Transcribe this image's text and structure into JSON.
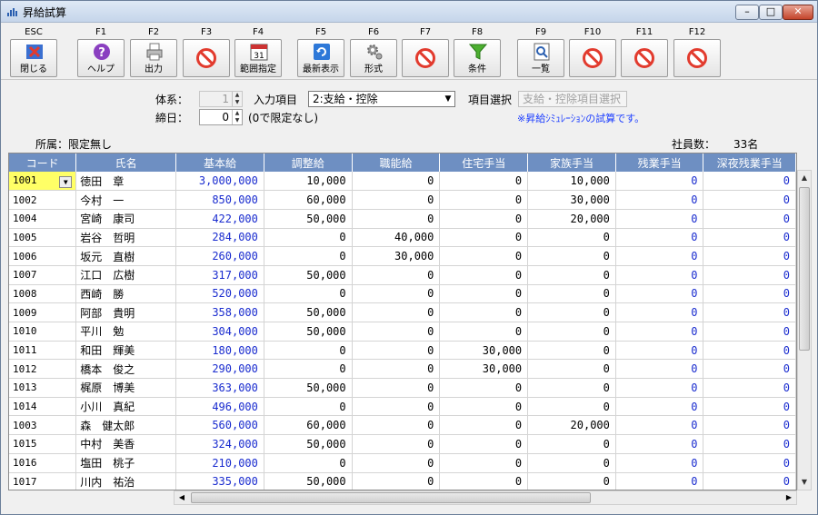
{
  "window": {
    "title": "昇給試算",
    "min": "–",
    "max": "□",
    "close": "✕"
  },
  "toolbar": [
    {
      "key": "ESC",
      "label": "閉じる",
      "icon": "close-icon"
    },
    {
      "key": "F1",
      "label": "ヘルプ",
      "icon": "help-icon"
    },
    {
      "key": "F2",
      "label": "出力",
      "icon": "printer-icon"
    },
    {
      "key": "F3",
      "label": "",
      "icon": "disabled-icon"
    },
    {
      "key": "F4",
      "label": "範囲指定",
      "icon": "calendar-icon",
      "badge": "31"
    },
    {
      "key": "F5",
      "label": "最新表示",
      "icon": "refresh-icon"
    },
    {
      "key": "F6",
      "label": "形式",
      "icon": "gear-icon"
    },
    {
      "key": "F7",
      "label": "",
      "icon": "disabled-icon"
    },
    {
      "key": "F8",
      "label": "条件",
      "icon": "filter-icon"
    },
    {
      "key": "F9",
      "label": "一覧",
      "icon": "list-icon"
    },
    {
      "key": "F10",
      "label": "",
      "icon": "disabled-icon"
    },
    {
      "key": "F11",
      "label": "",
      "icon": "disabled-icon"
    },
    {
      "key": "F12",
      "label": "",
      "icon": "disabled-icon"
    }
  ],
  "filters": {
    "taikei_label": "体系：",
    "taikei_value": "1",
    "input_item_label": "入力項目",
    "input_item_value": "2:支給・控除",
    "item_select_label": "項目選択",
    "item_select_value": "支給・控除項目選択",
    "shimebi_label": "締日：",
    "shimebi_value": "0",
    "shimebi_note": "(0で限定なし)",
    "note": "※昇給ｼﾐｭﾚｰｼｮﾝの試算です。",
    "affiliation": "所属：限定無し",
    "employee_count_label": "社員数：",
    "employee_count": "33名"
  },
  "columns": [
    "コード",
    "氏名",
    "基本給",
    "調整給",
    "職能給",
    "住宅手当",
    "家族手当",
    "残業手当",
    "深夜残業手当"
  ],
  "rows": [
    [
      "1001",
      "徳田　章",
      "3,000,000",
      "10,000",
      "0",
      "0",
      "10,000",
      "0",
      "0"
    ],
    [
      "1002",
      "今村　一",
      "850,000",
      "60,000",
      "0",
      "0",
      "30,000",
      "0",
      "0"
    ],
    [
      "1004",
      "宮崎　康司",
      "422,000",
      "50,000",
      "0",
      "0",
      "20,000",
      "0",
      "0"
    ],
    [
      "1005",
      "岩谷　哲明",
      "284,000",
      "0",
      "40,000",
      "0",
      "0",
      "0",
      "0"
    ],
    [
      "1006",
      "坂元　直樹",
      "260,000",
      "0",
      "30,000",
      "0",
      "0",
      "0",
      "0"
    ],
    [
      "1007",
      "江口　広樹",
      "317,000",
      "50,000",
      "0",
      "0",
      "0",
      "0",
      "0"
    ],
    [
      "1008",
      "西崎　勝",
      "520,000",
      "0",
      "0",
      "0",
      "0",
      "0",
      "0"
    ],
    [
      "1009",
      "阿部　貴明",
      "358,000",
      "50,000",
      "0",
      "0",
      "0",
      "0",
      "0"
    ],
    [
      "1010",
      "平川　勉",
      "304,000",
      "50,000",
      "0",
      "0",
      "0",
      "0",
      "0"
    ],
    [
      "1011",
      "和田　輝美",
      "180,000",
      "0",
      "0",
      "30,000",
      "0",
      "0",
      "0"
    ],
    [
      "1012",
      "橋本　俊之",
      "290,000",
      "0",
      "0",
      "30,000",
      "0",
      "0",
      "0"
    ],
    [
      "1013",
      "梶原　博美",
      "363,000",
      "50,000",
      "0",
      "0",
      "0",
      "0",
      "0"
    ],
    [
      "1014",
      "小川　真紀",
      "496,000",
      "0",
      "0",
      "0",
      "0",
      "0",
      "0"
    ],
    [
      "1003",
      "森　健太郎",
      "560,000",
      "60,000",
      "0",
      "0",
      "20,000",
      "0",
      "0"
    ],
    [
      "1015",
      "中村　美香",
      "324,000",
      "50,000",
      "0",
      "0",
      "0",
      "0",
      "0"
    ],
    [
      "1016",
      "塩田　桃子",
      "210,000",
      "0",
      "0",
      "0",
      "0",
      "0",
      "0"
    ],
    [
      "1017",
      "川内　祐治",
      "335,000",
      "50,000",
      "0",
      "0",
      "0",
      "0",
      "0"
    ]
  ]
}
